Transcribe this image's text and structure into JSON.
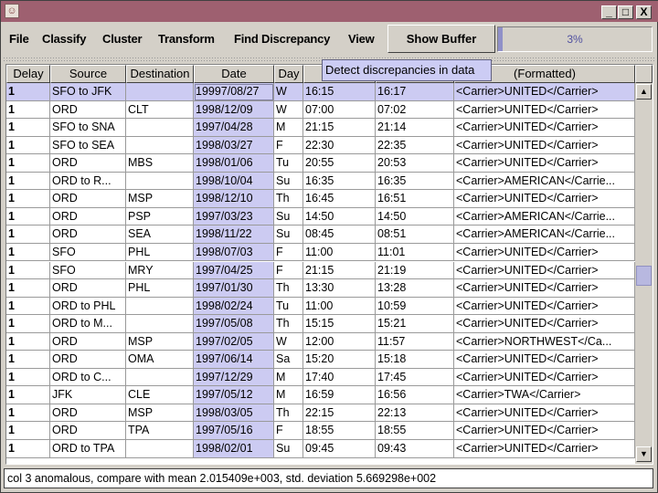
{
  "window": {
    "app_icon": "java-duke-icon",
    "controls": {
      "minimize": "_",
      "maximize": "□",
      "close": "X"
    }
  },
  "menu": [
    "File",
    "Classify",
    "Cluster",
    "Transform",
    "Find Discrepancy",
    "View"
  ],
  "show_buffer_label": "Show Buffer",
  "progress": {
    "percent": 3,
    "label": "3%",
    "color": "#9090c8"
  },
  "tooltip": "Detect discrepancies in data",
  "table": {
    "headers": [
      "Delay",
      "Source",
      "Destination",
      "Date",
      "Day",
      "D",
      "",
      "(Formatted)"
    ],
    "selected_row": 0,
    "highlight_color": "#cccbf2",
    "rows": [
      [
        "1",
        "SFO to JFK",
        "",
        "19997/08/27",
        "W",
        "16:15",
        "16:17",
        "<Carrier>UNITED</Carrier>"
      ],
      [
        "1",
        "ORD",
        "CLT",
        "1998/12/09",
        "W",
        "07:00",
        "07:02",
        "<Carrier>UNITED</Carrier>"
      ],
      [
        "1",
        "SFO to SNA",
        "",
        "1997/04/28",
        "M",
        "21:15",
        "21:14",
        "<Carrier>UNITED</Carrier>"
      ],
      [
        "1",
        "SFO to SEA",
        "",
        "1998/03/27",
        "F",
        "22:30",
        "22:35",
        "<Carrier>UNITED</Carrier>"
      ],
      [
        "1",
        "ORD",
        "MBS",
        "1998/01/06",
        "Tu",
        "20:55",
        "20:53",
        "<Carrier>UNITED</Carrier>"
      ],
      [
        "1",
        "ORD to R...",
        "",
        "1998/10/04",
        "Su",
        "16:35",
        "16:35",
        "<Carrier>AMERICAN</Carrie..."
      ],
      [
        "1",
        "ORD",
        "MSP",
        "1998/12/10",
        "Th",
        "16:45",
        "16:51",
        "<Carrier>UNITED</Carrier>"
      ],
      [
        "1",
        "ORD",
        "PSP",
        "1997/03/23",
        "Su",
        "14:50",
        "14:50",
        "<Carrier>AMERICAN</Carrie..."
      ],
      [
        "1",
        "ORD",
        "SEA",
        "1998/11/22",
        "Su",
        "08:45",
        "08:51",
        "<Carrier>AMERICAN</Carrie..."
      ],
      [
        "1",
        "SFO",
        "PHL",
        "1998/07/03",
        "F",
        "11:00",
        "11:01",
        "<Carrier>UNITED</Carrier>"
      ],
      [
        "1",
        "SFO",
        "MRY",
        "1997/04/25",
        "F",
        "21:15",
        "21:19",
        "<Carrier>UNITED</Carrier>"
      ],
      [
        "1",
        "ORD",
        "PHL",
        "1997/01/30",
        "Th",
        "13:30",
        "13:28",
        "<Carrier>UNITED</Carrier>"
      ],
      [
        "1",
        "ORD to PHL",
        "",
        "1998/02/24",
        "Tu",
        "11:00",
        "10:59",
        "<Carrier>UNITED</Carrier>"
      ],
      [
        "1",
        "ORD to M...",
        "",
        "1997/05/08",
        "Th",
        "15:15",
        "15:21",
        "<Carrier>UNITED</Carrier>"
      ],
      [
        "1",
        "ORD",
        "MSP",
        "1997/02/05",
        "W",
        "12:00",
        "11:57",
        "<Carrier>NORTHWEST</Ca..."
      ],
      [
        "1",
        "ORD",
        "OMA",
        "1997/06/14",
        "Sa",
        "15:20",
        "15:18",
        "<Carrier>UNITED</Carrier>"
      ],
      [
        "1",
        "ORD to C...",
        "",
        "1997/12/29",
        "M",
        "17:40",
        "17:45",
        "<Carrier>UNITED</Carrier>"
      ],
      [
        "1",
        "JFK",
        "CLE",
        "1997/05/12",
        "M",
        "16:59",
        "16:56",
        "<Carrier>TWA</Carrier>"
      ],
      [
        "1",
        "ORD",
        "MSP",
        "1998/03/05",
        "Th",
        "22:15",
        "22:13",
        "<Carrier>UNITED</Carrier>"
      ],
      [
        "1",
        "ORD",
        "TPA",
        "1997/05/16",
        "F",
        "18:55",
        "18:55",
        "<Carrier>UNITED</Carrier>"
      ],
      [
        "1",
        "ORD to TPA",
        "",
        "1998/02/01",
        "Su",
        "09:45",
        "09:43",
        "<Carrier>UNITED</Carrier>"
      ]
    ]
  },
  "status": "col 3 anomalous, compare with mean 2.015409e+003, std. deviation 5.669298e+002"
}
